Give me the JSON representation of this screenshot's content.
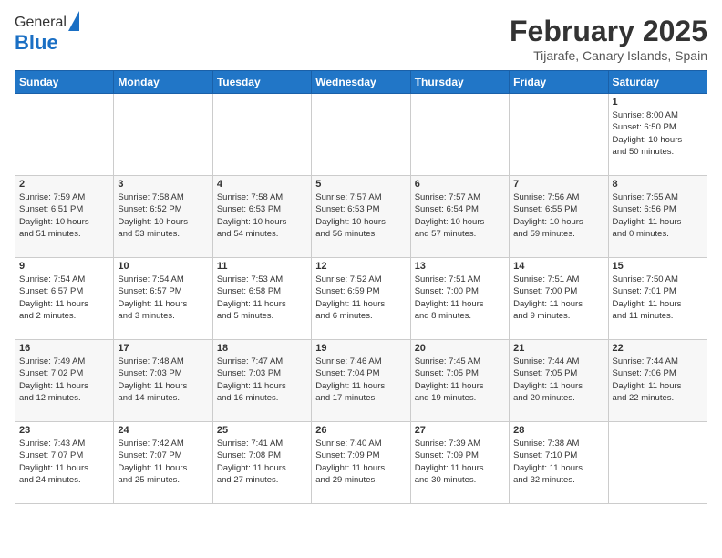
{
  "header": {
    "logo_line1": "General",
    "logo_line2": "Blue",
    "month_title": "February 2025",
    "location": "Tijarafe, Canary Islands, Spain"
  },
  "weekdays": [
    "Sunday",
    "Monday",
    "Tuesday",
    "Wednesday",
    "Thursday",
    "Friday",
    "Saturday"
  ],
  "weeks": [
    [
      {
        "day": "",
        "info": ""
      },
      {
        "day": "",
        "info": ""
      },
      {
        "day": "",
        "info": ""
      },
      {
        "day": "",
        "info": ""
      },
      {
        "day": "",
        "info": ""
      },
      {
        "day": "",
        "info": ""
      },
      {
        "day": "1",
        "info": "Sunrise: 8:00 AM\nSunset: 6:50 PM\nDaylight: 10 hours\nand 50 minutes."
      }
    ],
    [
      {
        "day": "2",
        "info": "Sunrise: 7:59 AM\nSunset: 6:51 PM\nDaylight: 10 hours\nand 51 minutes."
      },
      {
        "day": "3",
        "info": "Sunrise: 7:58 AM\nSunset: 6:52 PM\nDaylight: 10 hours\nand 53 minutes."
      },
      {
        "day": "4",
        "info": "Sunrise: 7:58 AM\nSunset: 6:53 PM\nDaylight: 10 hours\nand 54 minutes."
      },
      {
        "day": "5",
        "info": "Sunrise: 7:57 AM\nSunset: 6:53 PM\nDaylight: 10 hours\nand 56 minutes."
      },
      {
        "day": "6",
        "info": "Sunrise: 7:57 AM\nSunset: 6:54 PM\nDaylight: 10 hours\nand 57 minutes."
      },
      {
        "day": "7",
        "info": "Sunrise: 7:56 AM\nSunset: 6:55 PM\nDaylight: 10 hours\nand 59 minutes."
      },
      {
        "day": "8",
        "info": "Sunrise: 7:55 AM\nSunset: 6:56 PM\nDaylight: 11 hours\nand 0 minutes."
      }
    ],
    [
      {
        "day": "9",
        "info": "Sunrise: 7:54 AM\nSunset: 6:57 PM\nDaylight: 11 hours\nand 2 minutes."
      },
      {
        "day": "10",
        "info": "Sunrise: 7:54 AM\nSunset: 6:57 PM\nDaylight: 11 hours\nand 3 minutes."
      },
      {
        "day": "11",
        "info": "Sunrise: 7:53 AM\nSunset: 6:58 PM\nDaylight: 11 hours\nand 5 minutes."
      },
      {
        "day": "12",
        "info": "Sunrise: 7:52 AM\nSunset: 6:59 PM\nDaylight: 11 hours\nand 6 minutes."
      },
      {
        "day": "13",
        "info": "Sunrise: 7:51 AM\nSunset: 7:00 PM\nDaylight: 11 hours\nand 8 minutes."
      },
      {
        "day": "14",
        "info": "Sunrise: 7:51 AM\nSunset: 7:00 PM\nDaylight: 11 hours\nand 9 minutes."
      },
      {
        "day": "15",
        "info": "Sunrise: 7:50 AM\nSunset: 7:01 PM\nDaylight: 11 hours\nand 11 minutes."
      }
    ],
    [
      {
        "day": "16",
        "info": "Sunrise: 7:49 AM\nSunset: 7:02 PM\nDaylight: 11 hours\nand 12 minutes."
      },
      {
        "day": "17",
        "info": "Sunrise: 7:48 AM\nSunset: 7:03 PM\nDaylight: 11 hours\nand 14 minutes."
      },
      {
        "day": "18",
        "info": "Sunrise: 7:47 AM\nSunset: 7:03 PM\nDaylight: 11 hours\nand 16 minutes."
      },
      {
        "day": "19",
        "info": "Sunrise: 7:46 AM\nSunset: 7:04 PM\nDaylight: 11 hours\nand 17 minutes."
      },
      {
        "day": "20",
        "info": "Sunrise: 7:45 AM\nSunset: 7:05 PM\nDaylight: 11 hours\nand 19 minutes."
      },
      {
        "day": "21",
        "info": "Sunrise: 7:44 AM\nSunset: 7:05 PM\nDaylight: 11 hours\nand 20 minutes."
      },
      {
        "day": "22",
        "info": "Sunrise: 7:44 AM\nSunset: 7:06 PM\nDaylight: 11 hours\nand 22 minutes."
      }
    ],
    [
      {
        "day": "23",
        "info": "Sunrise: 7:43 AM\nSunset: 7:07 PM\nDaylight: 11 hours\nand 24 minutes."
      },
      {
        "day": "24",
        "info": "Sunrise: 7:42 AM\nSunset: 7:07 PM\nDaylight: 11 hours\nand 25 minutes."
      },
      {
        "day": "25",
        "info": "Sunrise: 7:41 AM\nSunset: 7:08 PM\nDaylight: 11 hours\nand 27 minutes."
      },
      {
        "day": "26",
        "info": "Sunrise: 7:40 AM\nSunset: 7:09 PM\nDaylight: 11 hours\nand 29 minutes."
      },
      {
        "day": "27",
        "info": "Sunrise: 7:39 AM\nSunset: 7:09 PM\nDaylight: 11 hours\nand 30 minutes."
      },
      {
        "day": "28",
        "info": "Sunrise: 7:38 AM\nSunset: 7:10 PM\nDaylight: 11 hours\nand 32 minutes."
      },
      {
        "day": "",
        "info": ""
      }
    ]
  ]
}
